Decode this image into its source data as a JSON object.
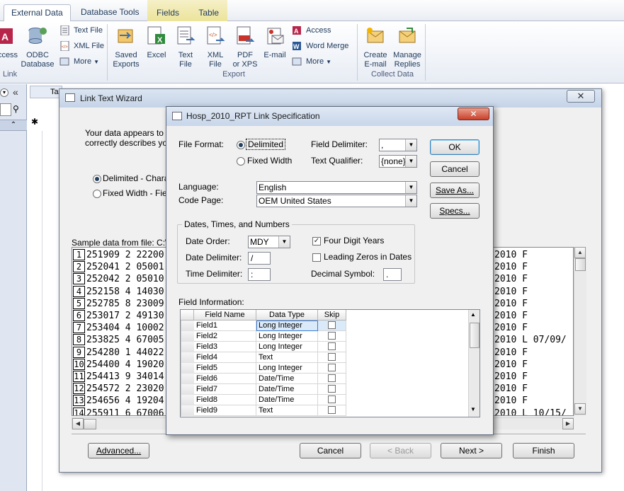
{
  "ribbon": {
    "tabs": [
      "External Data",
      "Database Tools",
      "Fields",
      "Table"
    ],
    "import_group": {
      "access_label": "ccess",
      "odbc_label_1": "ODBC",
      "odbc_label_2": "Database",
      "text_file": "Text File",
      "xml_file": "XML File",
      "more": "More",
      "group_label": "Link"
    },
    "export_group": {
      "saved_exports_1": "Saved",
      "saved_exports_2": "Exports",
      "excel": "Excel",
      "text_file_1": "Text",
      "text_file_2": "File",
      "xml_file_1": "XML",
      "xml_file_2": "File",
      "pdf_1": "PDF",
      "pdf_2": "or XPS",
      "email": "E-mail",
      "access": "Access",
      "word_merge": "Word Merge",
      "more": "More",
      "group_label": "Export"
    },
    "collect_group": {
      "create_email_1": "Create",
      "create_email_2": "E-mail",
      "manage_replies_1": "Manage",
      "manage_replies_2": "Replies",
      "group_label": "Collect Data"
    }
  },
  "doc": {
    "tab_label": "Ta",
    "new_row_marker": "✱"
  },
  "wizard": {
    "title": "Link Text Wizard",
    "intro_1": "Your data appears to b",
    "intro_2": "correctly describes you",
    "radio_delimited": "Delimited - Characi",
    "radio_fixed": "Fixed Width - Field",
    "sample_label": "Sample data from file: C:\\US",
    "sample_rows": [
      {
        "n": "1",
        "left": "251909 2 22200",
        "right": "2010 F"
      },
      {
        "n": "2",
        "left": "252041 2 05001",
        "right": "2010 F"
      },
      {
        "n": "3",
        "left": "252042 2 05010",
        "right": "2010 F"
      },
      {
        "n": "4",
        "left": "252158 4 14030",
        "right": "2010 F"
      },
      {
        "n": "5",
        "left": "252785 8 23009",
        "right": "2010 F"
      },
      {
        "n": "6",
        "left": "253017 2 49130",
        "right": "2010 F"
      },
      {
        "n": "7",
        "left": "253404 4 10002",
        "right": "2010 F"
      },
      {
        "n": "8",
        "left": "253825 4 67005",
        "right": "2010 L 07/09/"
      },
      {
        "n": "9",
        "left": "254280 1 44022",
        "right": "2010 F"
      },
      {
        "n": "10",
        "left": "254400 4 19020",
        "right": "2010 F"
      },
      {
        "n": "11",
        "left": "254413 9 34014",
        "right": "2010 F"
      },
      {
        "n": "12",
        "left": "254572 2 23020",
        "right": "2010 F"
      },
      {
        "n": "13",
        "left": "254656 4 19204",
        "right": "2010 F"
      },
      {
        "n": "14",
        "left": "255911 6 67006",
        "right": "2010 L 10/15/"
      }
    ],
    "buttons": {
      "advanced": "Advanced...",
      "cancel": "Cancel",
      "back": "< Back",
      "next": "Next >",
      "finish": "Finish"
    }
  },
  "spec": {
    "title": "Hosp_2010_RPT Link Specification",
    "file_format_label": "File Format:",
    "delimited": "Delimited",
    "fixed_width": "Fixed Width",
    "field_delimiter_label": "Field Delimiter:",
    "field_delimiter_value": ",",
    "text_qualifier_label": "Text Qualifier:",
    "text_qualifier_value": "{none}",
    "language_label": "Language:",
    "language_value": "English",
    "code_page_label": "Code Page:",
    "code_page_value": "OEM United States",
    "dates_group": "Dates, Times, and Numbers",
    "date_order_label": "Date Order:",
    "date_order_value": "MDY",
    "date_delimiter_label": "Date Delimiter:",
    "date_delimiter_value": "/",
    "time_delimiter_label": "Time Delimiter:",
    "time_delimiter_value": ":",
    "four_digit_years": "Four Digit Years",
    "leading_zeros": "Leading Zeros in Dates",
    "decimal_symbol_label": "Decimal Symbol:",
    "decimal_symbol_value": ".",
    "field_info_label": "Field Information:",
    "columns": [
      "Field Name",
      "Data Type",
      "Skip"
    ],
    "fields": [
      {
        "name": "Field1",
        "type": "Long Integer"
      },
      {
        "name": "Field2",
        "type": "Long Integer"
      },
      {
        "name": "Field3",
        "type": "Long Integer"
      },
      {
        "name": "Field4",
        "type": "Text"
      },
      {
        "name": "Field5",
        "type": "Long Integer"
      },
      {
        "name": "Field6",
        "type": "Date/Time"
      },
      {
        "name": "Field7",
        "type": "Date/Time"
      },
      {
        "name": "Field8",
        "type": "Date/Time"
      },
      {
        "name": "Field9",
        "type": "Text"
      }
    ],
    "buttons": {
      "ok": "OK",
      "cancel": "Cancel",
      "save_as": "Save As...",
      "specs": "Specs..."
    }
  },
  "colors": {
    "accent": "#1e395b",
    "close_red": "#c9402a"
  }
}
